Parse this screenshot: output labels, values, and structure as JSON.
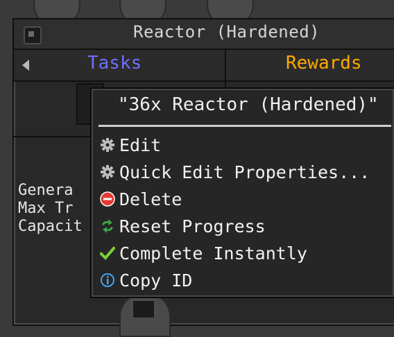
{
  "window": {
    "title": "Reactor (Hardened)"
  },
  "tabs": {
    "tasks": "Tasks",
    "rewards": "Rewards"
  },
  "description": {
    "lines": [
      "Genera",
      "Max Tr",
      "Capacit"
    ]
  },
  "context_menu": {
    "title": "\"36x Reactor (Hardened)\"",
    "items": [
      {
        "label": "Edit",
        "icon": "gear-icon"
      },
      {
        "label": "Quick Edit Properties...",
        "icon": "gear-icon"
      },
      {
        "label": "Delete",
        "icon": "delete-icon"
      },
      {
        "label": "Reset Progress",
        "icon": "reset-icon"
      },
      {
        "label": "Complete Instantly",
        "icon": "check-icon"
      },
      {
        "label": "Copy ID",
        "icon": "info-icon"
      }
    ]
  },
  "colors": {
    "tasks_tab": "#6f6fff",
    "rewards_tab": "#ffaa00",
    "delete_icon": "#e53935",
    "reset_icon": "#43a047",
    "check_icon": "#7cd23a",
    "info_icon": "#42a5f5"
  }
}
